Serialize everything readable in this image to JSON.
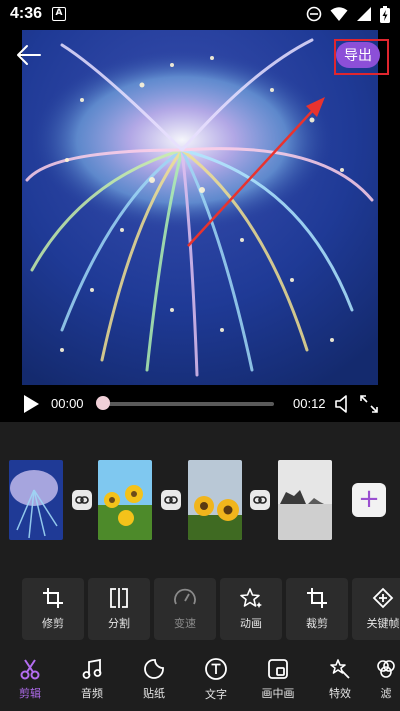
{
  "status": {
    "time": "4:36",
    "notif_letter": "A"
  },
  "top": {
    "export_label": "导出"
  },
  "player": {
    "current_time": "00:00",
    "total_time": "00:12",
    "progress": 0
  },
  "tools": [
    {
      "label": "修剪",
      "icon": "crop-icon",
      "enabled": true
    },
    {
      "label": "分割",
      "icon": "split-icon",
      "enabled": true
    },
    {
      "label": "变速",
      "icon": "speed-gauge-icon",
      "enabled": false
    },
    {
      "label": "动画",
      "icon": "sparkle-star-icon",
      "enabled": true
    },
    {
      "label": "裁剪",
      "icon": "crop-icon",
      "enabled": true
    },
    {
      "label": "关键帧",
      "icon": "keyframe-icon",
      "enabled": true
    }
  ],
  "tabs": [
    {
      "label": "剪辑",
      "icon": "scissors-icon",
      "active": true
    },
    {
      "label": "音频",
      "icon": "music-note-icon",
      "active": false
    },
    {
      "label": "贴纸",
      "icon": "sticker-icon",
      "active": false
    },
    {
      "label": "文字",
      "icon": "text-icon",
      "active": false
    },
    {
      "label": "画中画",
      "icon": "picture-in-picture-icon",
      "active": false
    },
    {
      "label": "特效",
      "icon": "magic-wand-icon",
      "active": false
    },
    {
      "label": "滤",
      "icon": "filter-icon",
      "active": false
    }
  ],
  "colors": {
    "accent": "#b36df0",
    "export_bg": "#8c4fd8",
    "highlight_border": "#e0262e",
    "arrow": "#e8332e"
  }
}
